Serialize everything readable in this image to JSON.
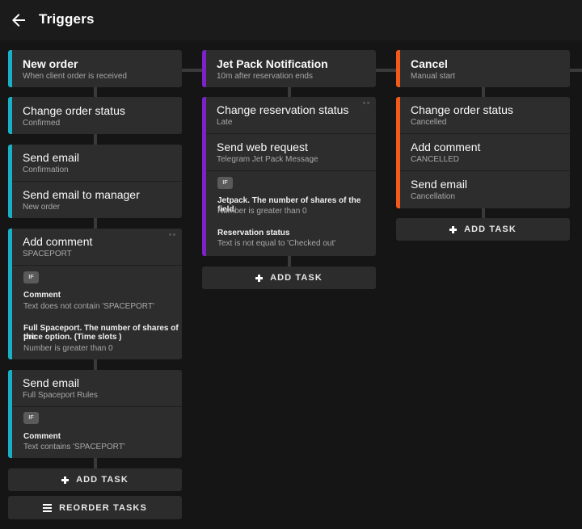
{
  "header": {
    "title": "Triggers"
  },
  "columns": [
    {
      "trigger": {
        "title": "New order",
        "subtitle": "When client order is received"
      },
      "tasks": [
        {
          "title": "Change order status",
          "subtitle": "Confirmed"
        },
        {
          "title": "Send email",
          "subtitle": "Confirmation"
        },
        {
          "title": "Send email to manager",
          "subtitle": "New order"
        },
        {
          "title": "Add comment",
          "subtitle": "SPACEPORT",
          "if_label": "IF",
          "conditions": [
            {
              "title": "Comment",
              "text": "Text does not contain 'SPACEPORT'"
            },
            {
              "title_line1": "Full Spaceport. The number of shares of the",
              "title_line2": "price option. (Time slots )",
              "text": "Number is greater than 0"
            }
          ]
        },
        {
          "title": "Send email",
          "subtitle": "Full Spaceport Rules",
          "if_label": "IF",
          "conditions": [
            {
              "title": "Comment",
              "text": "Text contains 'SPACEPORT'"
            }
          ]
        }
      ],
      "add_task_label": "ADD TASK",
      "reorder_label": "REORDER TASKS"
    },
    {
      "trigger": {
        "title": "Jet Pack Notification",
        "subtitle": "10m after reservation ends"
      },
      "tasks": [
        {
          "title": "Change reservation status",
          "subtitle": "Late"
        },
        {
          "title": "Send web request",
          "subtitle": "Telegram Jet Pack Message",
          "if_label": "IF",
          "conditions": [
            {
              "title": "Jetpack. The number of shares of the field.",
              "text": "Number is greater than 0"
            },
            {
              "title": "Reservation status",
              "text": "Text is not equal to 'Checked out'"
            }
          ]
        }
      ],
      "add_task_label": "ADD TASK"
    },
    {
      "trigger": {
        "title": "Cancel",
        "subtitle": "Manual start"
      },
      "tasks": [
        {
          "title": "Change order status",
          "subtitle": "Cancelled"
        },
        {
          "title": "Add comment",
          "subtitle": "CANCELLED"
        },
        {
          "title": "Send email",
          "subtitle": "Cancellation"
        }
      ],
      "add_task_label": "ADD TASK"
    }
  ],
  "colors": {
    "cyan": "#17b0c7",
    "purple": "#7b23c9",
    "orange": "#f25a1c",
    "background": "#151515",
    "card": "#2d2d2d"
  },
  "icons": {
    "back": "arrow-left-icon",
    "add": "plus-icon",
    "reorder": "menu-icon",
    "drag": "drag-handle-icon",
    "condition": "if-badge"
  }
}
